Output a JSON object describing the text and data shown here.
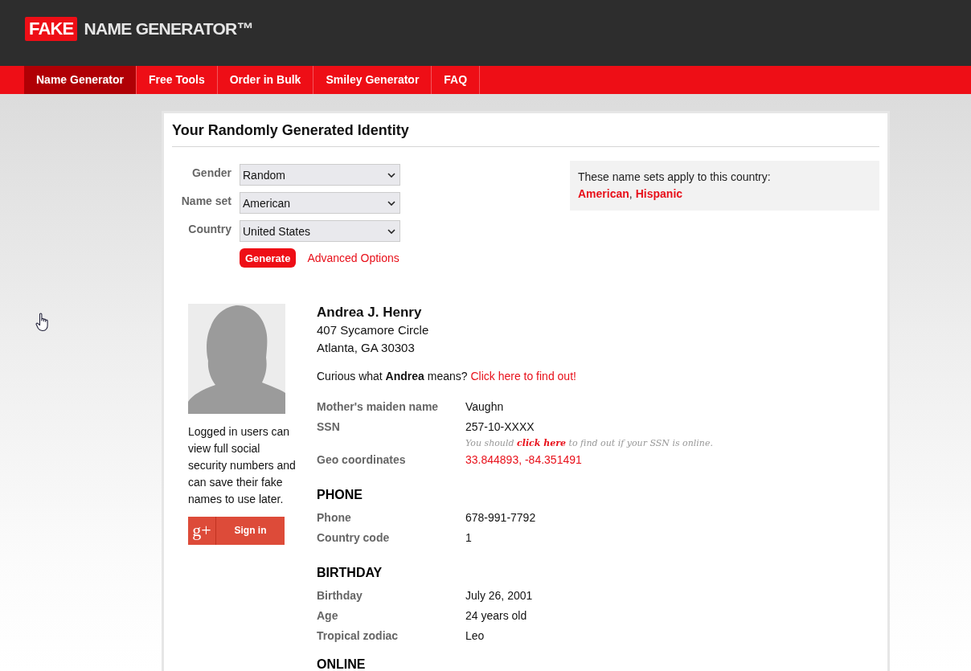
{
  "header": {
    "logo": {
      "badge": "FAKE",
      "text": "NAME GENERATOR™"
    }
  },
  "nav": [
    {
      "label": "Name Generator",
      "selected": true
    },
    {
      "label": "Free Tools",
      "selected": false
    },
    {
      "label": "Order in Bulk",
      "selected": false
    },
    {
      "label": "Smiley Generator",
      "selected": false
    },
    {
      "label": "FAQ",
      "selected": false
    }
  ],
  "card": {
    "title": "Your Randomly Generated Identity",
    "form": {
      "fields": [
        {
          "label": "Gender",
          "value": "Random"
        },
        {
          "label": "Name set",
          "value": "American"
        },
        {
          "label": "Country",
          "value": "United States"
        }
      ],
      "generate_button": "Generate",
      "advanced_link": "Advanced Options"
    },
    "name_sets": {
      "text": "These name sets apply to this country:",
      "links": [
        "American",
        "Hispanic"
      ],
      "separator": ","
    },
    "identity": {
      "login_note": "Logged in users can view full social security numbers and can save their fake names to use later.",
      "signin_button": {
        "icon_text": "g+",
        "label": "Sign in"
      },
      "name": "Andrea J. Henry",
      "address": [
        "407 Sycamore Circle",
        "Atlanta, GA 30303"
      ],
      "meaning": {
        "text": "Curious what **Andrea** means?",
        "link": "Click here to find out!"
      },
      "details": [
        {
          "label": "Mother's maiden name",
          "value": "Vaughn",
          "kind": "text"
        },
        {
          "label": "SSN",
          "value": "257-10-XXXX",
          "kind": "text",
          "note": {
            "before": "You should",
            "link": "click here",
            "after": "to find out if your SSN is online."
          }
        },
        {
          "label": "Geo coordinates",
          "value": "33.844893, -84.351491",
          "kind": "link"
        }
      ],
      "sections": [
        {
          "heading": "PHONE",
          "rows": [
            {
              "label": "Phone",
              "value": "678-991-7792",
              "kind": "text"
            },
            {
              "label": "Country code",
              "value": "1",
              "kind": "text"
            }
          ]
        },
        {
          "heading": "BIRTHDAY",
          "rows": [
            {
              "label": "Birthday",
              "value": "July 26, 2001",
              "kind": "text"
            },
            {
              "label": "Age",
              "value": "24 years old",
              "kind": "text"
            },
            {
              "label": "Tropical zodiac",
              "value": "Leo",
              "kind": "text"
            }
          ]
        },
        {
          "heading": "ONLINE"
        }
      ]
    }
  }
}
